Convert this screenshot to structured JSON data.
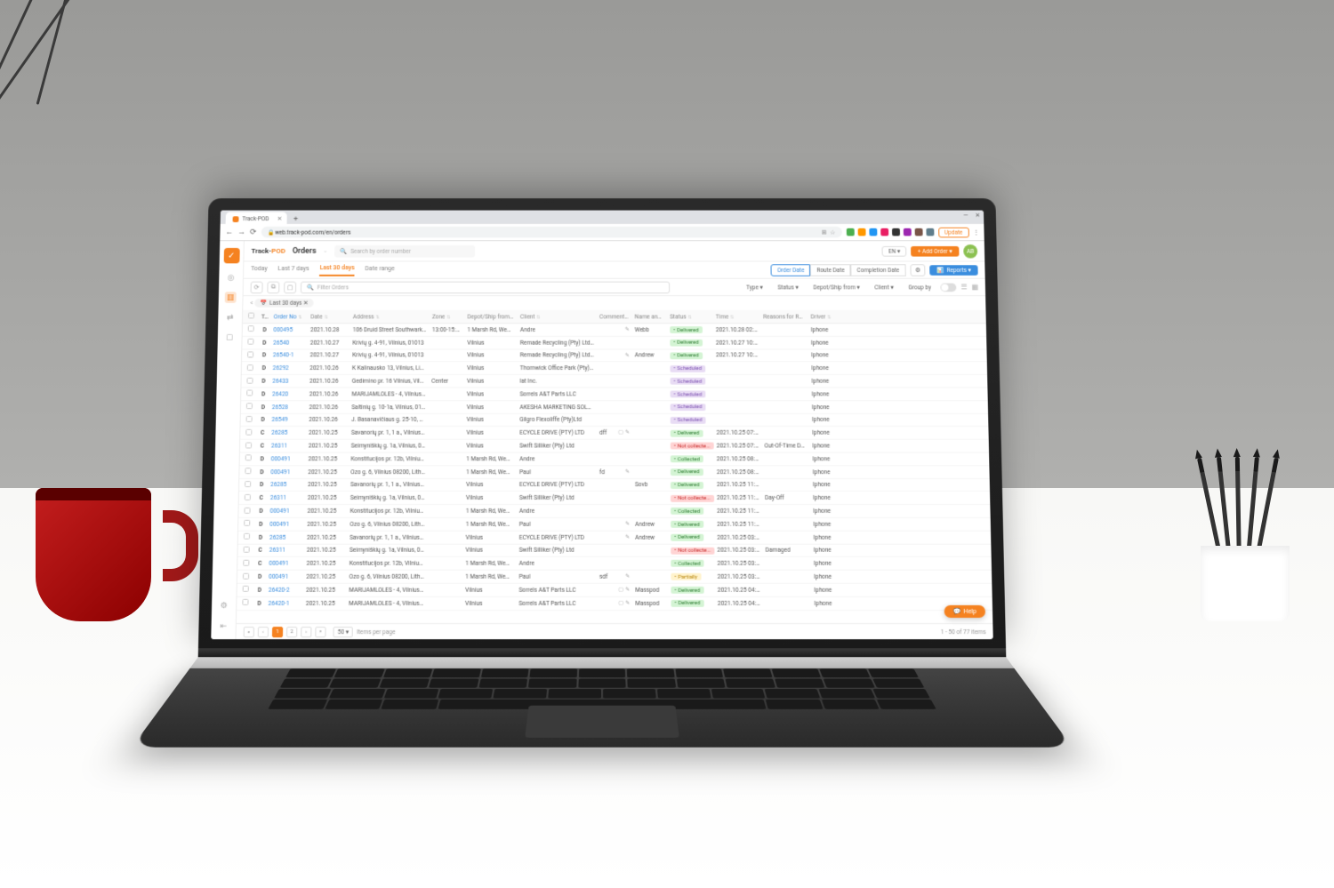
{
  "browser": {
    "tab_title": "Track-POD",
    "url": "web.track-pod.com/en/orders",
    "update_btn": "Update"
  },
  "topbar": {
    "brand_a": "Track-",
    "brand_b": "POD",
    "crumb": "Orders",
    "search_placeholder": "Search by order number",
    "lang": "EN ▾",
    "add_order": "+ Add Order ▾",
    "avatar": "AB"
  },
  "date_tabs": {
    "t0": "Today",
    "t1": "Last 7 days",
    "t2": "Last 30 days",
    "t3": "Date range"
  },
  "seg": {
    "s0": "Order Date",
    "s1": "Route Date",
    "s2": "Completion Date"
  },
  "reports_label": "Reports ▾",
  "filter_placeholder": "Filter Orders",
  "filters": {
    "f0": "Type ▾",
    "f1": "Status ▾",
    "f2": "Depot/Ship from ▾",
    "f3": "Client ▾",
    "f4": "Group by"
  },
  "chip": "Last 30 days ✕",
  "columns": {
    "type": "T...",
    "id": "Order No",
    "date": "Date",
    "addr": "Address",
    "zone": "Zone",
    "depot": "Depot/Ship from",
    "client": "Client",
    "comment": "Comment",
    "name": "Name and ePOD",
    "status": "Status",
    "time": "Time",
    "reason": "Reasons for Reje...",
    "driver": "Driver"
  },
  "rows": [
    {
      "t": "D",
      "id": "000495",
      "date": "2021.10.28",
      "addr": "106 Druid Street Southwark, L...",
      "zone": "13:00-15:00",
      "depot": "1 Marsh Rd, Wemble...",
      "client": "Andre",
      "comment": "",
      "ci": "p",
      "name": "Webb",
      "status": "Delivered",
      "sc": "st-delivered",
      "time": "2021.10.28 02:0...",
      "reason": "",
      "driver": "Iphone"
    },
    {
      "t": "D",
      "id": "26540",
      "date": "2021.10.27",
      "addr": "Krivių g. 4-91, Vilnius, 01013",
      "zone": "",
      "depot": "Vilnius",
      "client": "Remade Recycling (Pty) Ltd - ...",
      "comment": "",
      "ci": "",
      "name": "",
      "status": "Delivered",
      "sc": "st-delivered",
      "time": "2021.10.27 10:1...",
      "reason": "",
      "driver": "Iphone"
    },
    {
      "t": "D",
      "id": "26540-1",
      "date": "2021.10.27",
      "addr": "Krivių g. 4-91, Vilnius, 01013",
      "zone": "",
      "depot": "Vilnius",
      "client": "Remade Recycling (Pty) Ltd - ...",
      "comment": "",
      "ci": "p",
      "name": "Andrew",
      "status": "Delivered",
      "sc": "st-delivered",
      "time": "2021.10.27 10:2...",
      "reason": "",
      "driver": "Iphone"
    },
    {
      "t": "D",
      "id": "26292",
      "date": "2021.10.26",
      "addr": "K Kalinausko 13, Vilnius, Lietu...",
      "zone": "",
      "depot": "Vilnius",
      "client": "Thornwick Office Park (Pty) Ltd",
      "comment": "",
      "ci": "",
      "name": "",
      "status": "Scheduled",
      "sc": "st-scheduled",
      "time": "",
      "reason": "",
      "driver": "Iphone"
    },
    {
      "t": "D",
      "id": "26433",
      "date": "2021.10.26",
      "addr": "Gedimino pr. 16 Vilnius, Vilniau...",
      "zone": "Center",
      "depot": "Vilnius",
      "client": "lat Inc.",
      "comment": "",
      "ci": "",
      "name": "",
      "status": "Scheduled",
      "sc": "st-scheduled",
      "time": "",
      "reason": "",
      "driver": "Iphone"
    },
    {
      "t": "D",
      "id": "26420",
      "date": "2021.10.26",
      "addr": "MARIJAMLOLES - 4, Vilnius, 0...",
      "zone": "",
      "depot": "Vilnius",
      "client": "Sorrels A&T Parts LLC",
      "comment": "",
      "ci": "",
      "name": "",
      "status": "Scheduled",
      "sc": "st-scheduled",
      "time": "",
      "reason": "",
      "driver": "Iphone"
    },
    {
      "t": "D",
      "id": "26528",
      "date": "2021.10.26",
      "addr": "Šaltinių g. 10-1a, Vilnius, 01913",
      "zone": "",
      "depot": "Vilnius",
      "client": "AKESHA MARKETING SOLUTI...",
      "comment": "",
      "ci": "",
      "name": "",
      "status": "Scheduled",
      "sc": "st-scheduled",
      "time": "",
      "reason": "",
      "driver": "Iphone"
    },
    {
      "t": "D",
      "id": "26549",
      "date": "2021.10.26",
      "addr": "J. Basanavičiaus g. 25-10, Vil...",
      "zone": "",
      "depot": "Vilnius",
      "client": "Gilgro Flexoliffe (Pty)Ltd",
      "comment": "",
      "ci": "",
      "name": "",
      "status": "Scheduled",
      "sc": "st-scheduled",
      "time": "",
      "reason": "",
      "driver": "Iphone"
    },
    {
      "t": "C",
      "id": "26285",
      "date": "2021.10.25",
      "addr": "Savanorių pr. 1, 1 a., Vilnius, 0...",
      "zone": "",
      "depot": "Vilnius",
      "client": "ECYCLE DRIVE (PTY) LTD",
      "comment": "dff",
      "ci": "np",
      "name": "",
      "status": "Delivered",
      "sc": "st-delivered",
      "time": "2021.10.25 07:4...",
      "reason": "",
      "driver": "Iphone"
    },
    {
      "t": "C",
      "id": "26311",
      "date": "2021.10.25",
      "addr": "Šeimyniškių g. 1a, Vilnius, 093...",
      "zone": "",
      "depot": "Vilnius",
      "client": "Swift Silliker (Pty) Ltd",
      "comment": "",
      "ci": "",
      "name": "",
      "status": "Not collecte...",
      "sc": "st-notcoll",
      "time": "2021.10.25 07:5...",
      "reason": "Out-Of-Time Delivery",
      "driver": "Iphone"
    },
    {
      "t": "D",
      "id": "000491",
      "date": "2021.10.25",
      "addr": "Konstitucijos pr. 12b, Vilnius 0...",
      "zone": "",
      "depot": "1 Marsh Rd, Wemble...",
      "client": "Andre",
      "comment": "",
      "ci": "",
      "name": "",
      "status": "Collected",
      "sc": "st-collected",
      "time": "2021.10.25 08:0...",
      "reason": "",
      "driver": "Iphone"
    },
    {
      "t": "D",
      "id": "000491",
      "date": "2021.10.25",
      "addr": "Ozo g. 6, Vilnius 08200, Lithua...",
      "zone": "",
      "depot": "1 Marsh Rd, Wemble...",
      "client": "Paul",
      "comment": "fd",
      "ci": "p",
      "name": "",
      "status": "Delivered",
      "sc": "st-delivered",
      "time": "2021.10.25 08:5...",
      "reason": "",
      "driver": "Iphone"
    },
    {
      "t": "D",
      "id": "26285",
      "date": "2021.10.25",
      "addr": "Savanorių pr. 1, 1 a., Vilnius, 0...",
      "zone": "",
      "depot": "Vilnius",
      "client": "ECYCLE DRIVE (PTY) LTD",
      "comment": "",
      "ci": "",
      "name": "Sovb",
      "status": "Delivered",
      "sc": "st-delivered",
      "time": "2021.10.25 11:2...",
      "reason": "",
      "driver": "Iphone"
    },
    {
      "t": "C",
      "id": "26311",
      "date": "2021.10.25",
      "addr": "Šeimyniškių g. 1a, Vilnius, 093...",
      "zone": "",
      "depot": "Vilnius",
      "client": "Swift Silliker (Pty) Ltd",
      "comment": "",
      "ci": "",
      "name": "",
      "status": "Not collecte...",
      "sc": "st-notcoll",
      "time": "2021.10.25 11:2...",
      "reason": "Day-Off",
      "driver": "Iphone"
    },
    {
      "t": "D",
      "id": "000491",
      "date": "2021.10.25",
      "addr": "Konstitucijos pr. 12b, Vilnius 0...",
      "zone": "",
      "depot": "1 Marsh Rd, Wemble...",
      "client": "Andre",
      "comment": "",
      "ci": "",
      "name": "",
      "status": "Collected",
      "sc": "st-collected",
      "time": "2021.10.25 11:5...",
      "reason": "",
      "driver": "Iphone"
    },
    {
      "t": "D",
      "id": "000491",
      "date": "2021.10.25",
      "addr": "Ozo g. 6, Vilnius 08200, Lithua...",
      "zone": "",
      "depot": "1 Marsh Rd, Wemble...",
      "client": "Paul",
      "comment": "",
      "ci": "p",
      "name": "Andrew",
      "status": "Delivered",
      "sc": "st-delivered",
      "time": "2021.10.25 11:5...",
      "reason": "",
      "driver": "Iphone"
    },
    {
      "t": "D",
      "id": "26285",
      "date": "2021.10.25",
      "addr": "Savanorių pr. 1, 1 a., Vilnius, 0...",
      "zone": "",
      "depot": "Vilnius",
      "client": "ECYCLE DRIVE (PTY) LTD",
      "comment": "",
      "ci": "p",
      "name": "Andrew",
      "status": "Delivered",
      "sc": "st-delivered",
      "time": "2021.10.25 03:3...",
      "reason": "",
      "driver": "Iphone"
    },
    {
      "t": "C",
      "id": "26311",
      "date": "2021.10.25",
      "addr": "Šeimyniškių g. 1a, Vilnius, 093...",
      "zone": "",
      "depot": "Vilnius",
      "client": "Swift Silliker (Pty) Ltd",
      "comment": "",
      "ci": "",
      "name": "",
      "status": "Not collecte...",
      "sc": "st-notcoll",
      "time": "2021.10.25 03:3...",
      "reason": "Damaged",
      "driver": "Iphone"
    },
    {
      "t": "C",
      "id": "000491",
      "date": "2021.10.25",
      "addr": "Konstitucijos pr. 12b, Vilnius 0...",
      "zone": "",
      "depot": "1 Marsh Rd, Wemble...",
      "client": "Andre",
      "comment": "",
      "ci": "",
      "name": "",
      "status": "Collected",
      "sc": "st-collected",
      "time": "2021.10.25 03:3...",
      "reason": "",
      "driver": "Iphone"
    },
    {
      "t": "D",
      "id": "000491",
      "date": "2021.10.25",
      "addr": "Ozo g. 6, Vilnius 08200, Lithua...",
      "zone": "",
      "depot": "1 Marsh Rd, Wemble...",
      "client": "Paul",
      "comment": "sdf",
      "ci": "p",
      "name": "",
      "status": "Partially",
      "sc": "st-partially",
      "time": "2021.10.25 03:3...",
      "reason": "",
      "driver": "Iphone"
    },
    {
      "t": "D",
      "id": "26420-2",
      "date": "2021.10.25",
      "addr": "MARIJAMLOLES - 4, Vilnius, 0...",
      "zone": "",
      "depot": "Vilnius",
      "client": "Sorrels A&T Parts LLC",
      "comment": "",
      "ci": "np",
      "name": "Masspod",
      "status": "Delivered",
      "sc": "st-delivered",
      "time": "2021.10.25 04:5...",
      "reason": "",
      "driver": "Iphone"
    },
    {
      "t": "D",
      "id": "26420-1",
      "date": "2021.10.25",
      "addr": "MARIJAMLOLES - 4, Vilnius, 0...",
      "zone": "",
      "depot": "Vilnius",
      "client": "Sorrels A&T Parts LLC",
      "comment": "",
      "ci": "np",
      "name": "Masspod",
      "status": "Delivered",
      "sc": "st-delivered",
      "time": "2021.10.25 04:5...",
      "reason": "",
      "driver": "Iphone"
    }
  ],
  "pagination": {
    "page_size": "50 ▾",
    "label": "Items per page",
    "summary": "1 - 50 of 77 items"
  },
  "help": "Help"
}
